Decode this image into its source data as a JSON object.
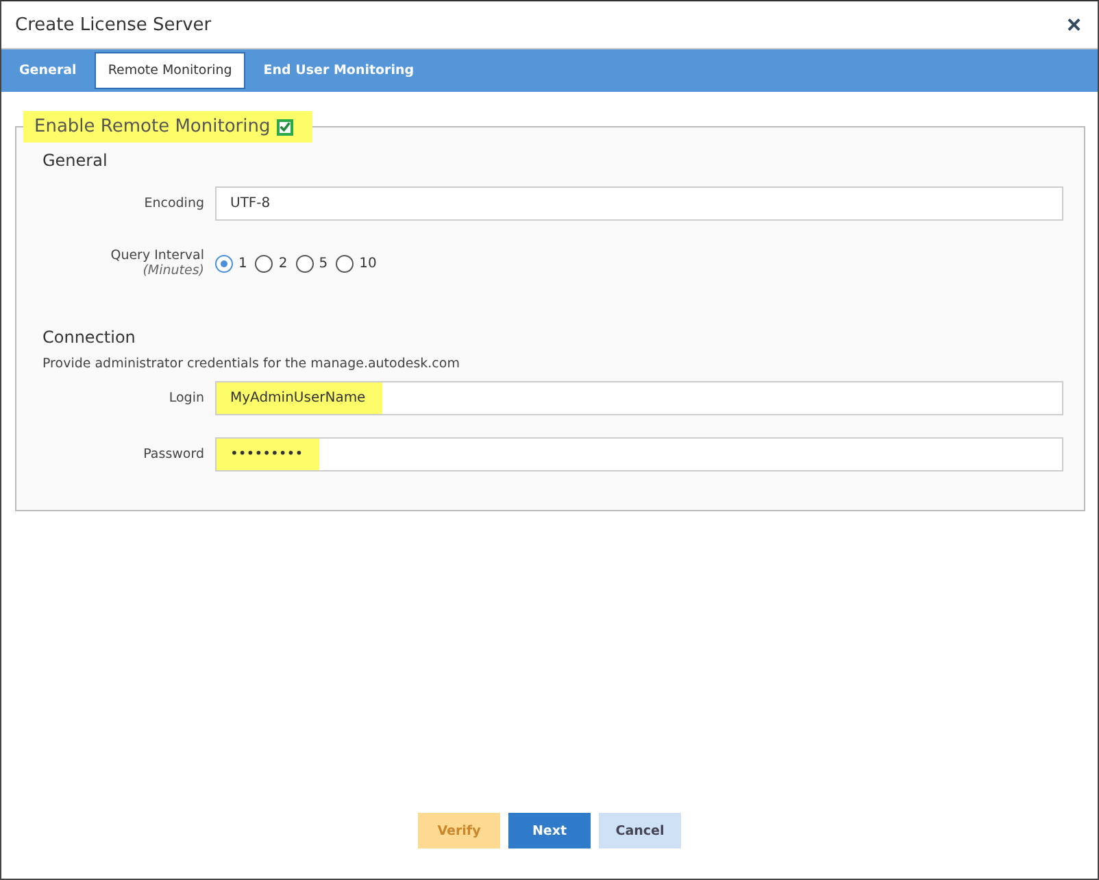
{
  "window": {
    "title": "Create License Server",
    "close": "×"
  },
  "tabs": [
    {
      "label": "General",
      "selected": false
    },
    {
      "label": "Remote Monitoring",
      "selected": true
    },
    {
      "label": "End User Monitoring",
      "selected": false
    }
  ],
  "section": {
    "title": "Enable Remote Monitoring",
    "checked": true,
    "highlighted": true
  },
  "general": {
    "heading": "General",
    "encoding": {
      "label": "Encoding",
      "value": "UTF-8"
    },
    "interval": {
      "label": "Query Interval",
      "unit": "(Minutes)",
      "options": [
        {
          "label": "1",
          "selected": true
        },
        {
          "label": "2",
          "selected": false
        },
        {
          "label": "5",
          "selected": false
        },
        {
          "label": "10",
          "selected": false
        }
      ]
    }
  },
  "connection": {
    "heading": "Connection",
    "note": "Provide administrator credentials for the manage.autodesk.com",
    "fields": [
      {
        "label": "Login",
        "value": "MyAdminUserName",
        "highlighted": true
      },
      {
        "label": "Password",
        "value": "•••••••••",
        "highlighted": true
      }
    ]
  },
  "buttons": [
    {
      "label": "Verify",
      "kind": "warning"
    },
    {
      "label": "Next",
      "kind": "primary"
    },
    {
      "label": "Cancel",
      "kind": "secondary"
    }
  ]
}
